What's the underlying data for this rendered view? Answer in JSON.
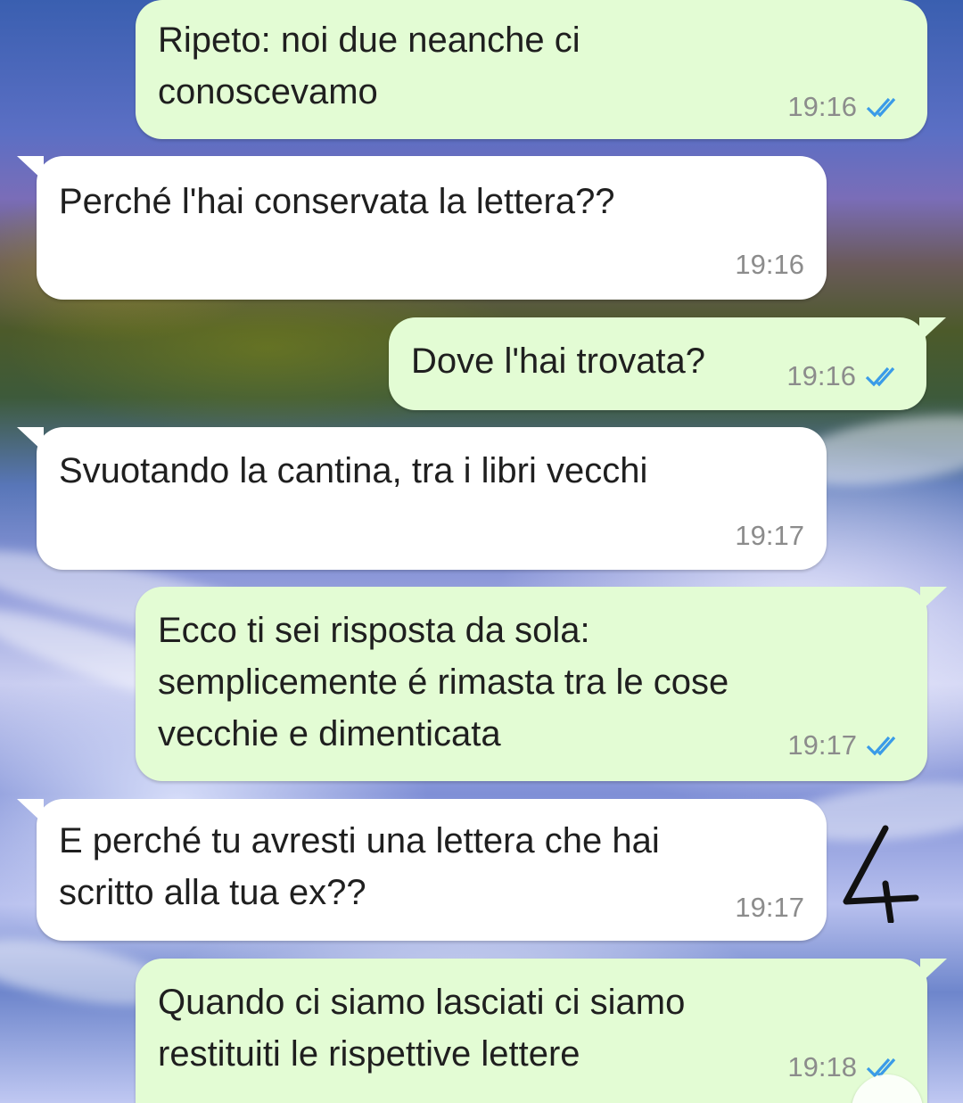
{
  "messages": [
    {
      "direction": "out",
      "text": "Ripeto: noi due neanche ci\nconoscevamo",
      "time": "19:16",
      "status": "read-double-check-icon"
    },
    {
      "direction": "in",
      "text": "Perché l'hai conservata la lettera??",
      "time": "19:16"
    },
    {
      "direction": "out",
      "text": "Dove l'hai trovata?",
      "time": "19:16",
      "status": "read-double-check-icon"
    },
    {
      "direction": "in",
      "text": "Svuotando la cantina, tra i libri vecchi",
      "time": "19:17"
    },
    {
      "direction": "out",
      "text": "Ecco ti sei risposta da sola:\nsemplicemente é rimasta tra le cose\nvecchie e dimenticata",
      "time": "19:17",
      "status": "read-double-check-icon"
    },
    {
      "direction": "in",
      "text": "E perché tu avresti una lettera che hai\nscritto alla tua ex??",
      "time": "19:17"
    },
    {
      "direction": "out",
      "text": "Quando ci siamo lasciati ci siamo\nrestituiti le rispettive lettere",
      "time": "19:18",
      "status": "read-double-check-icon"
    }
  ],
  "annotation": {
    "text": "4"
  },
  "colors": {
    "outgoing_bubble": "#e3fcd4",
    "incoming_bubble": "#ffffff",
    "read_ticks": "#3a9be8",
    "timestamp": "#8c8c8c"
  }
}
